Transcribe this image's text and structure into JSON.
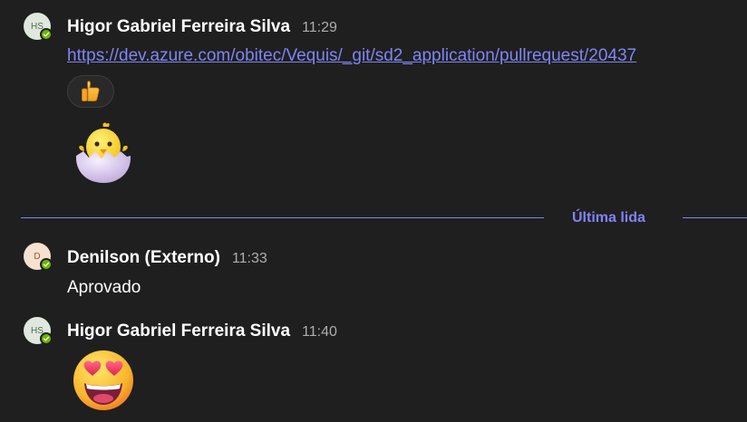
{
  "messages": [
    {
      "avatar_initials": "HS",
      "sender": "Higor Gabriel Ferreira Silva",
      "time": "11:29",
      "link": "https://dev.azure.com/obitec/Vequis/_git/sd2_application/pullrequest/20437",
      "reaction_icon": "thumbs-up-icon",
      "sticker": "hatching-chick-icon"
    },
    {
      "avatar_initials": "D",
      "sender": "Denilson (Externo)",
      "time": "11:33",
      "text": "Aprovado"
    },
    {
      "avatar_initials": "HS",
      "sender": "Higor Gabriel Ferreira Silva",
      "time": "11:40",
      "sticker": "heart-eyes-face-icon"
    }
  ],
  "divider": {
    "label": "Última lida"
  },
  "colors": {
    "background": "#1f1f1f",
    "link": "#7f85f5",
    "accent": "#7f85f5",
    "presence_available": "#6bb700"
  }
}
